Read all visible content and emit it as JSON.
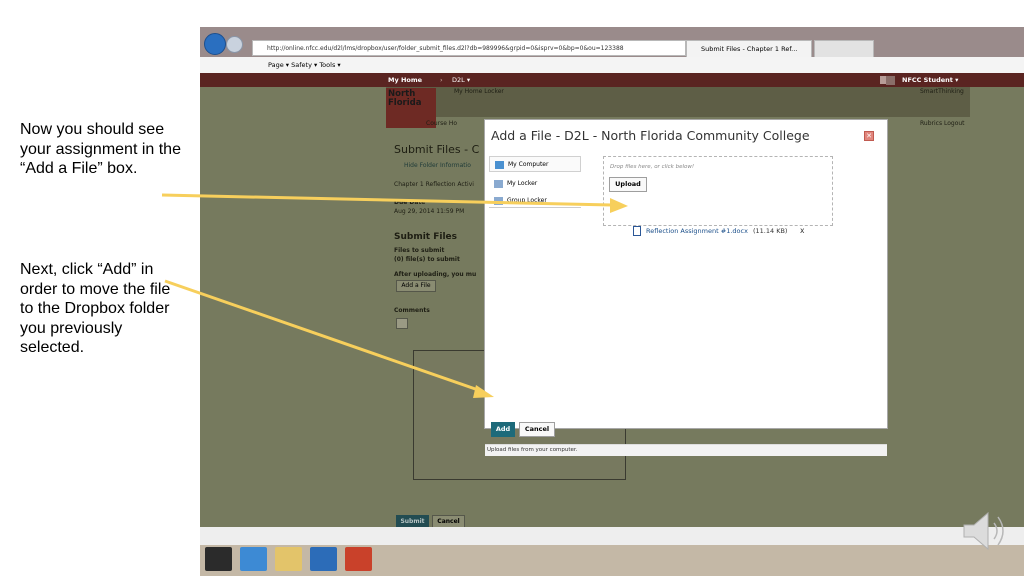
{
  "slide": {
    "note1": "Now you should see your assignment in the “Add a File” box.",
    "note2": "Next, click “Add” in order to move the file to the Dropbox folder you previously selected."
  },
  "browser": {
    "url": "http://online.nfcc.edu/d2l/lms/dropbox/user/folder_submit_files.d2l?db=989996&grpid=0&isprv=0&bp=0&ou=123388",
    "tab_title": "Submit Files - Chapter 1 Ref...",
    "command_bar": "Page ▾   Safety ▾   Tools ▾",
    "accent": "#5a2421"
  },
  "d2l": {
    "my_home": "My Home",
    "d2l_menu": "D2L ▾",
    "user": "NFCC Student ▾",
    "my_home_locker": "My Home Locker",
    "smart_thinking": "SmartThinking",
    "course_home": "Course Ho",
    "rubrics_logout": "Rubrics  Logout",
    "logo_line1": "North",
    "logo_line2": "Florida",
    "page_title": "Submit Files - C",
    "hide_folder": "Hide Folder Informatio",
    "folder_desc": "Chapter 1 Reflection Activi",
    "due_date_label": "Due Date",
    "due_date_value": "Aug 29, 2014 11:59 PM",
    "submit_files_heading": "Submit Files",
    "files_to_submit_label": "Files to submit",
    "files_count": "(0) file(s) to submit",
    "after_upload": "After uploading, you mu",
    "add_a_file": "Add a File",
    "comments_label": "Comments",
    "submit": "Submit",
    "cancel": "Cancel"
  },
  "dialog": {
    "title": "Add a File - D2L - North Florida Community College",
    "sources": [
      "My Computer",
      "My Locker",
      "Group Locker"
    ],
    "drop_hint": "Drop files here, or click below!",
    "upload": "Upload",
    "file_name": "Reflection Assignment #1.docx",
    "file_size": "(11.14 KB)",
    "remove": "x",
    "add": "Add",
    "cancel": "Cancel",
    "status": "Upload files from your computer.",
    "add_color": "#1d6a7a"
  },
  "colors": {
    "arrow": "#f7cf5c"
  }
}
